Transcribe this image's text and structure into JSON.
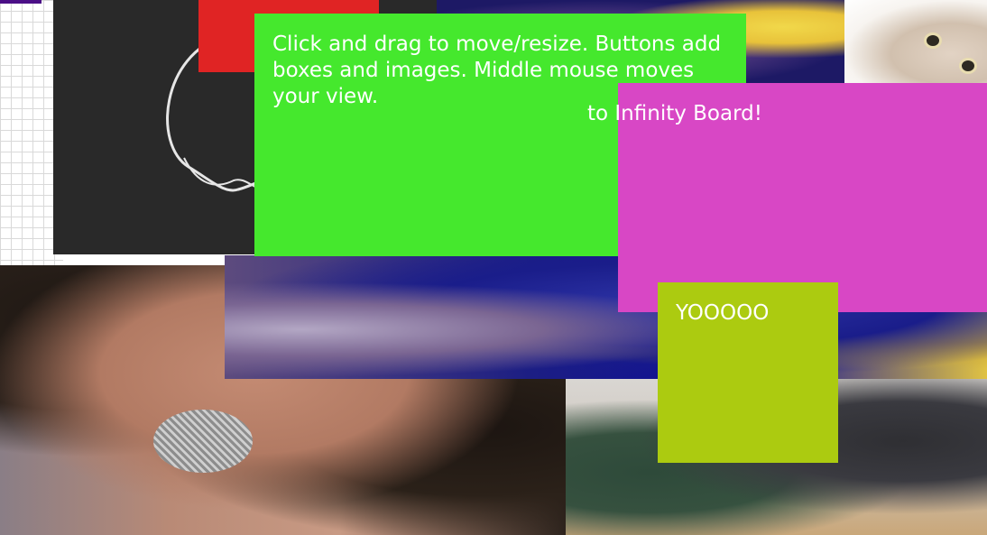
{
  "board": {
    "boxes": {
      "instructions_text": "Click and drag to move/resize. Buttons add boxes and images. Middle mouse moves your view.",
      "welcome_text": "to Infinity Board!",
      "yo_text": "YOOOOO"
    },
    "colors": {
      "green": "#45e82d",
      "magenta": "#d847c5",
      "lime": "#accb10",
      "red": "#e02424",
      "dark": "#292929",
      "purple": "#4b0f86"
    }
  }
}
